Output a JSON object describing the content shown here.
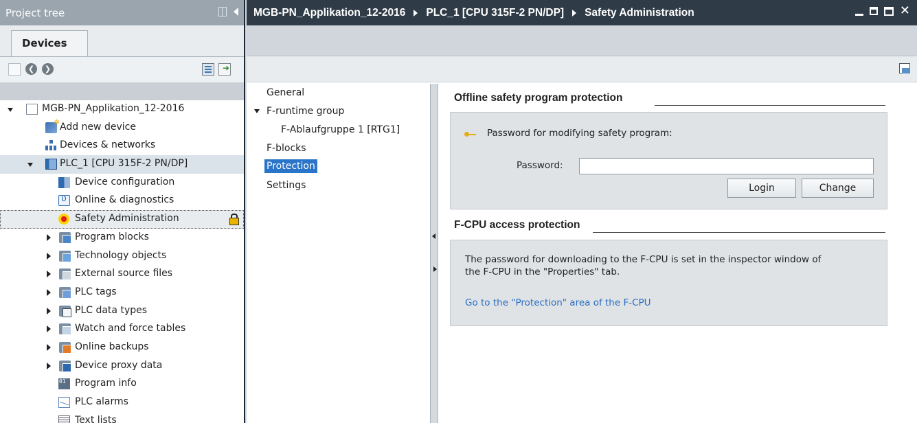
{
  "project_tree": {
    "title": "Project tree",
    "tab": "Devices",
    "items": [
      {
        "label": "MGB-PN_Applikation_12-2016",
        "indent": 0,
        "expander": "down",
        "icon": "project-icon"
      },
      {
        "label": "Add new device",
        "indent": 1,
        "expander": "none",
        "icon": "add-device-icon"
      },
      {
        "label": "Devices & networks",
        "indent": 1,
        "expander": "none",
        "icon": "network-icon"
      },
      {
        "label": "PLC_1 [CPU 315F-2 PN/DP]",
        "indent": 1,
        "expander": "down",
        "icon": "plc-icon"
      },
      {
        "label": "Device configuration",
        "indent": 2,
        "expander": "none",
        "icon": "device-config-icon"
      },
      {
        "label": "Online & diagnostics",
        "indent": 2,
        "expander": "none",
        "icon": "online-diagnostics-icon"
      },
      {
        "label": "Safety Administration",
        "indent": 2,
        "expander": "none",
        "icon": "safety-icon"
      },
      {
        "label": "Program blocks",
        "indent": 2,
        "expander": "right",
        "icon": "program-blocks-icon"
      },
      {
        "label": "Technology objects",
        "indent": 2,
        "expander": "right",
        "icon": "technology-objects-icon"
      },
      {
        "label": "External source files",
        "indent": 2,
        "expander": "right",
        "icon": "external-sources-icon"
      },
      {
        "label": "PLC tags",
        "indent": 2,
        "expander": "right",
        "icon": "plc-tags-icon"
      },
      {
        "label": "PLC data types",
        "indent": 2,
        "expander": "right",
        "icon": "plc-data-types-icon"
      },
      {
        "label": "Watch and force tables",
        "indent": 2,
        "expander": "right",
        "icon": "watch-tables-icon"
      },
      {
        "label": "Online backups",
        "indent": 2,
        "expander": "right",
        "icon": "online-backups-icon"
      },
      {
        "label": "Device proxy data",
        "indent": 2,
        "expander": "right",
        "icon": "device-proxy-icon"
      },
      {
        "label": "Program info",
        "indent": 2,
        "expander": "none",
        "icon": "program-info-icon"
      },
      {
        "label": "PLC alarms",
        "indent": 2,
        "expander": "none",
        "icon": "plc-alarms-icon"
      },
      {
        "label": "Text lists",
        "indent": 2,
        "expander": "none",
        "icon": "text-lists-icon"
      }
    ]
  },
  "breadcrumb": {
    "items": [
      "MGB-PN_Applikation_12-2016",
      "PLC_1 [CPU 315F-2 PN/DP]",
      "Safety Administration"
    ]
  },
  "nav": {
    "general": "General",
    "runtime_group": "F-runtime group",
    "runtime_child": "F-Ablaufgruppe 1 [RTG1]",
    "blocks": "F-blocks",
    "protection": "Protection",
    "settings": "Settings"
  },
  "offline_protection": {
    "title": "Offline safety program protection",
    "password_prompt": "Password for modifying safety program:",
    "password_label": "Password:",
    "password_value": "",
    "login_button": "Login",
    "change_button": "Change"
  },
  "fcpu_protection": {
    "title": "F-CPU access protection",
    "description_line1": "The password for downloading to the F-CPU is set in the inspector window of",
    "description_line2": "the F-CPU in the \"Properties\" tab.",
    "link": "Go to the \"Protection\" area of the F-CPU"
  },
  "colors": {
    "selection": "#2a74c9",
    "title_bar": "#2f3b46",
    "link": "#2a6fc4"
  }
}
